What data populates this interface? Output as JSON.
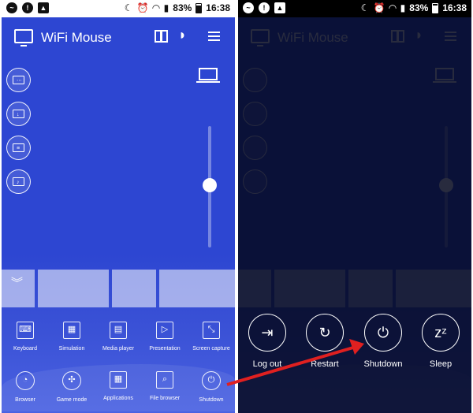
{
  "status_bar": {
    "battery": "83%",
    "time": "16:38"
  },
  "app": {
    "title": "WiFi Mouse",
    "icons": [
      "monitor-icon",
      "gift-icon",
      "wifi-icon",
      "menu-icon",
      "laptop-icon"
    ]
  },
  "folders": [
    "folder-list-icon",
    "folder-download-icon",
    "folder-document-icon",
    "folder-music-icon"
  ],
  "slider": {
    "level": 0.5
  },
  "toolbar_top": [
    {
      "label": "Keyboard",
      "icon": "keyboard-icon"
    },
    {
      "label": "Simulation",
      "icon": "simulation-icon"
    },
    {
      "label": "Media player",
      "icon": "media-player-icon"
    },
    {
      "label": "Presentation",
      "icon": "presentation-icon"
    },
    {
      "label": "Screen capture",
      "icon": "screen-capture-icon"
    }
  ],
  "toolbar_bottom": [
    {
      "label": "Browser",
      "icon": "browser-icon"
    },
    {
      "label": "Game mode",
      "icon": "gamepad-icon"
    },
    {
      "label": "Applications",
      "icon": "applications-icon"
    },
    {
      "label": "File browser",
      "icon": "file-browser-icon"
    },
    {
      "label": "Shutdown",
      "icon": "power-icon"
    }
  ],
  "power_menu": [
    {
      "label": "Log out",
      "icon": "logout-icon"
    },
    {
      "label": "Restart",
      "icon": "restart-icon"
    },
    {
      "label": "Shutdown",
      "icon": "power-icon"
    },
    {
      "label": "Sleep",
      "icon": "sleep-icon"
    }
  ],
  "colors": {
    "app_blue": "#2d46d2",
    "overlay": "#05081e",
    "arrow": "#e02020"
  }
}
